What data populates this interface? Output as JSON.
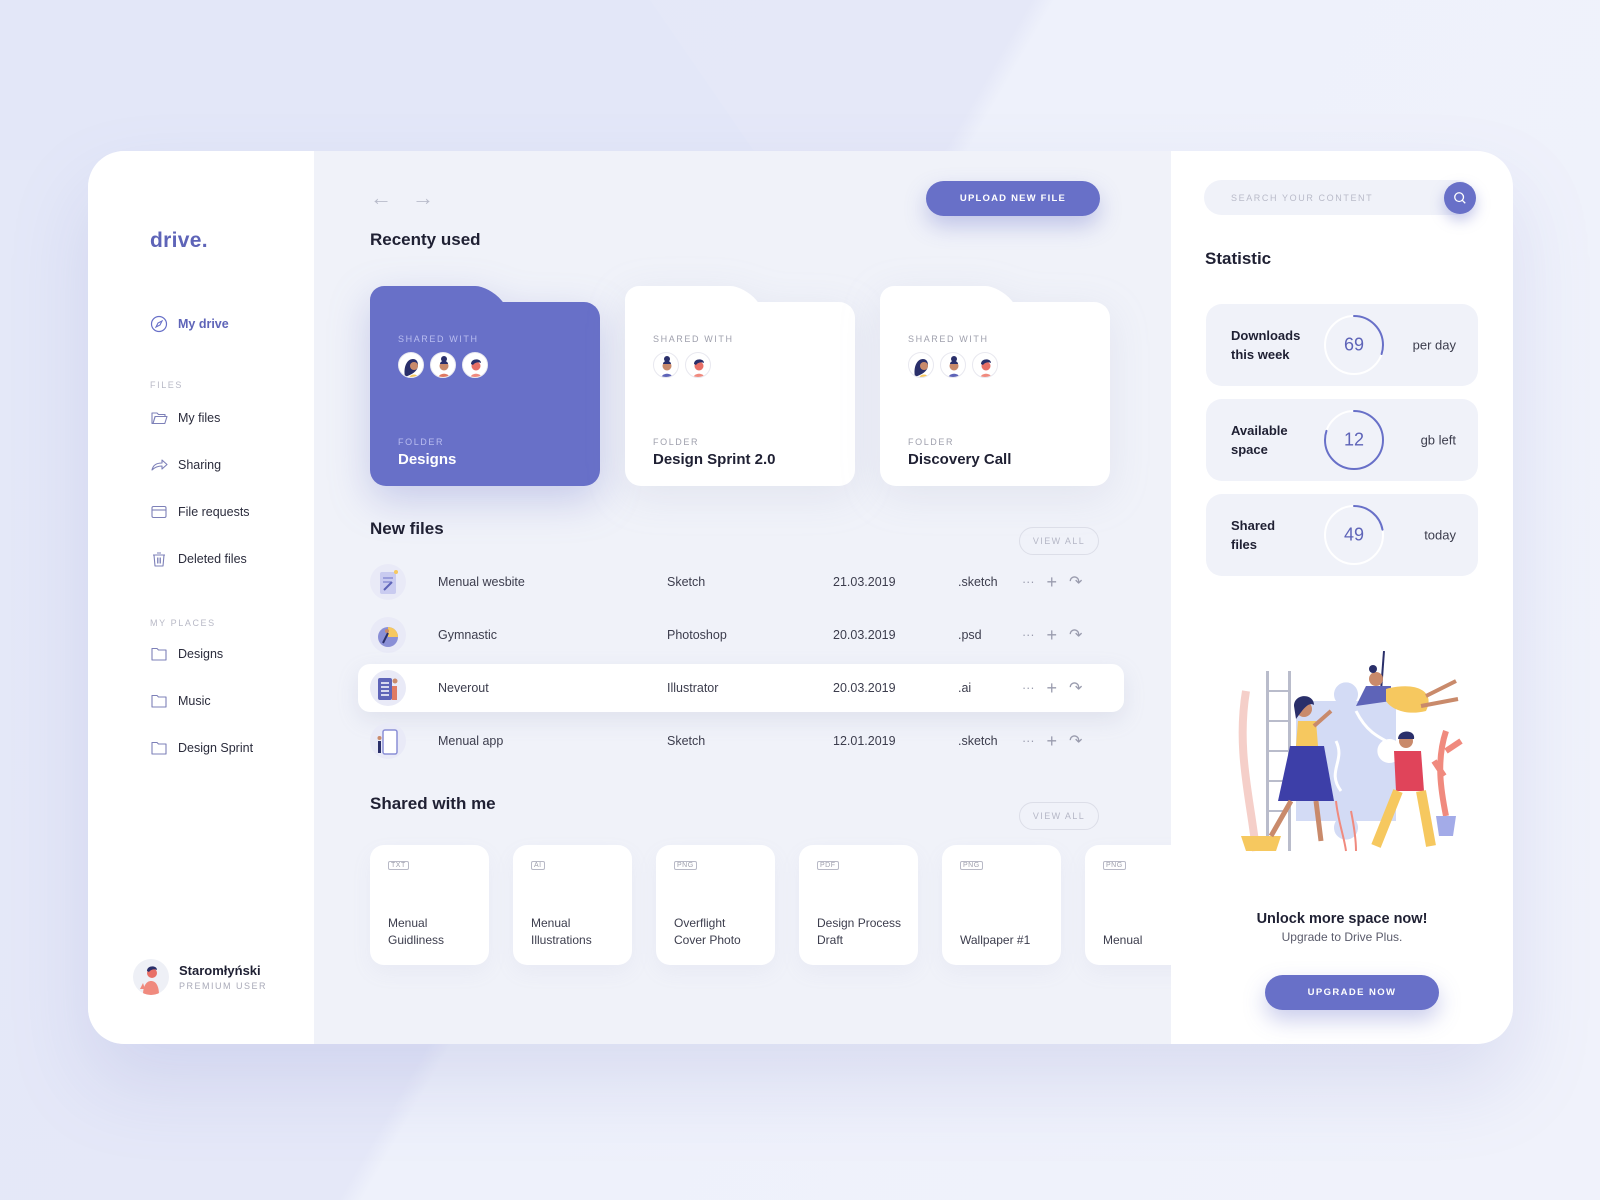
{
  "app": {
    "logo": "drive."
  },
  "sidebar": {
    "primary": {
      "label": "My drive",
      "icon": "compass-icon"
    },
    "files_section": "FILES",
    "files": [
      {
        "label": "My files",
        "icon": "folder-open-icon"
      },
      {
        "label": "Sharing",
        "icon": "share-icon"
      },
      {
        "label": "File requests",
        "icon": "inbox-icon"
      },
      {
        "label": "Deleted files",
        "icon": "trash-icon"
      }
    ],
    "places_section": "MY PLACES",
    "places": [
      {
        "label": "Designs",
        "icon": "folder-icon"
      },
      {
        "label": "Music",
        "icon": "folder-icon"
      },
      {
        "label": "Design Sprint",
        "icon": "folder-icon"
      }
    ],
    "user": {
      "name": "Staromłyński",
      "role": "PREMIUM USER"
    }
  },
  "main": {
    "nav": {
      "back": "←",
      "forward": "→"
    },
    "upload_label": "UPLOAD NEW FILE",
    "recent_title": "Recenty used",
    "folders": [
      {
        "shared_label": "SHARED WITH",
        "type_label": "FOLDER",
        "name": "Designs",
        "avatars": 3,
        "active": true
      },
      {
        "shared_label": "SHARED WITH",
        "type_label": "FOLDER",
        "name": "Design Sprint 2.0",
        "avatars": 2,
        "active": false
      },
      {
        "shared_label": "SHARED WITH",
        "type_label": "FOLDER",
        "name": "Discovery Call",
        "avatars": 3,
        "active": false
      }
    ],
    "new_files_title": "New files",
    "view_all": "VIEW ALL",
    "files": [
      {
        "name": "Menual wesbite",
        "app": "Sketch",
        "date": "21.03.2019",
        "ext": ".sketch"
      },
      {
        "name": "Gymnastic",
        "app": "Photoshop",
        "date": "20.03.2019",
        "ext": ".psd"
      },
      {
        "name": "Neverout",
        "app": "Illustrator",
        "date": "20.03.2019",
        "ext": ".ai"
      },
      {
        "name": "Menual app",
        "app": "Sketch",
        "date": "12.01.2019",
        "ext": ".sketch"
      }
    ],
    "row_actions": {
      "more": "···",
      "add": "+",
      "share": "↷"
    },
    "shared_title": "Shared with me",
    "shared": [
      {
        "type": "TXT",
        "name_1": "Menual",
        "name_2": "Guidliness"
      },
      {
        "type": "AI",
        "name_1": "Menual",
        "name_2": "Illustrations"
      },
      {
        "type": "PNG",
        "name_1": "Overflight",
        "name_2": "Cover Photo"
      },
      {
        "type": "PDF",
        "name_1": "Design Process",
        "name_2": "Draft"
      },
      {
        "type": "PNG",
        "name_1": "",
        "name_2": "Wallpaper #1"
      },
      {
        "type": "PNG",
        "name_1": "",
        "name_2": "Menual"
      }
    ]
  },
  "right": {
    "search_placeholder": "SEARCH YOUR CONTENT",
    "stat_title": "Statistic",
    "stats": [
      {
        "label_1": "Downloads",
        "label_2": "this week",
        "value": "69",
        "unit": "per day",
        "progress": 0.3
      },
      {
        "label_1": "Available",
        "label_2": "space",
        "value": "12",
        "unit": "gb left",
        "progress": 0.8
      },
      {
        "label_1": "Shared",
        "label_2": "files",
        "value": "49",
        "unit": "today",
        "progress": 0.22
      }
    ],
    "promo_title": "Unlock more space now!",
    "promo_sub": "Upgrade to Drive Plus.",
    "upgrade_label": "UPGRADE NOW"
  },
  "colors": {
    "accent": "#6870c8",
    "accent_text": "#5e64b8",
    "panel_bg": "#f0f2f9"
  }
}
